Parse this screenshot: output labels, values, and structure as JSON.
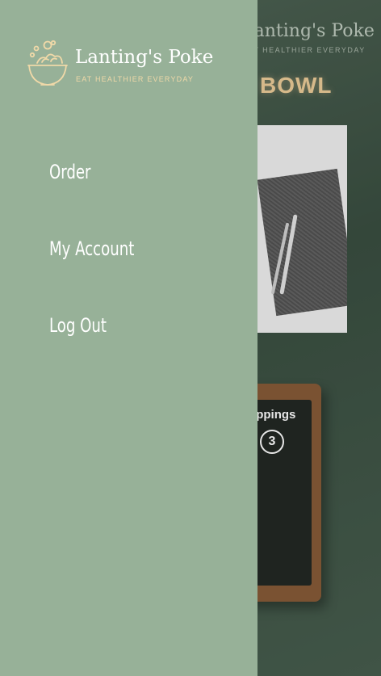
{
  "background": {
    "brand_name": "Lanting's Poke",
    "tagline": "EAT HEALTHIER EVERYDAY",
    "heading": "BOWL",
    "board_label": "Toppings",
    "board_number": "3"
  },
  "drawer": {
    "logo": {
      "name": "Lanting's Poke",
      "tagline": "EAT HEALTHIER EVERYDAY"
    },
    "menu": [
      {
        "label": "Order"
      },
      {
        "label": "My Account"
      },
      {
        "label": "Log Out"
      }
    ]
  },
  "colors": {
    "drawer_bg": "#97b198",
    "logo_gold": "#f0d9a8",
    "menu_text": "#ffffff"
  },
  "icons": {
    "logo": "poke-bowl-icon"
  }
}
